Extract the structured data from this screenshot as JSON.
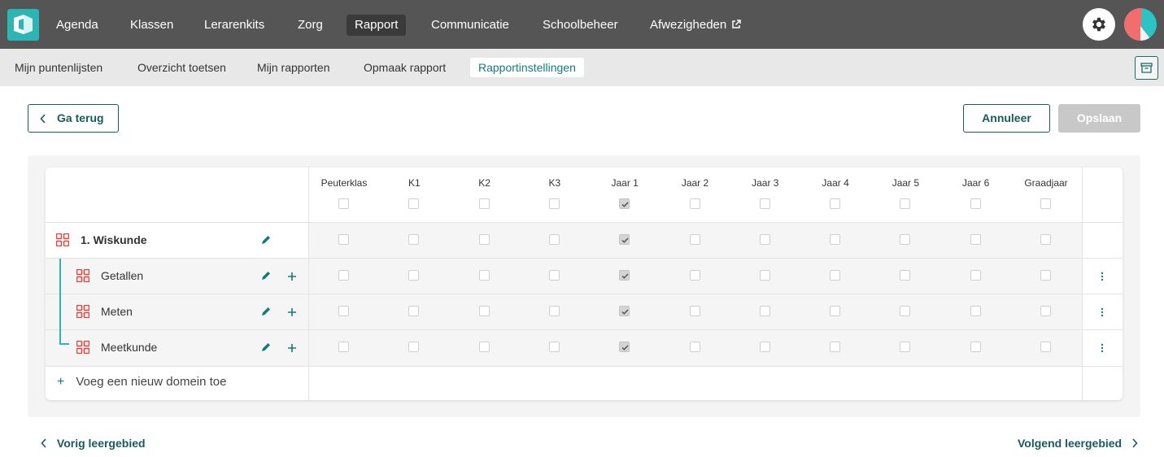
{
  "topnav": {
    "items": [
      "Agenda",
      "Klassen",
      "Lerarenkits",
      "Zorg",
      "Rapport",
      "Communicatie",
      "Schoolbeheer",
      "Afwezigheden"
    ],
    "active": "Rapport"
  },
  "subnav": {
    "items": [
      "Mijn puntenlijsten",
      "Overzicht toetsen",
      "Mijn rapporten",
      "Opmaak rapport",
      "Rapportinstellingen"
    ],
    "active": "Rapportinstellingen"
  },
  "actions": {
    "back": "Ga terug",
    "cancel": "Annuleer",
    "save": "Opslaan"
  },
  "table": {
    "columns": [
      "Peuterklas",
      "K1",
      "K2",
      "K3",
      "Jaar 1",
      "Jaar 2",
      "Jaar 3",
      "Jaar 4",
      "Jaar 5",
      "Jaar 6",
      "Graadjaar"
    ],
    "header_checked": [
      false,
      false,
      false,
      false,
      true,
      false,
      false,
      false,
      false,
      false,
      false
    ],
    "rows": [
      {
        "label": "1. Wiskunde",
        "level": 0,
        "checked": [
          false,
          false,
          false,
          false,
          true,
          false,
          false,
          false,
          false,
          false,
          false
        ]
      },
      {
        "label": "Getallen",
        "level": 1,
        "checked": [
          false,
          false,
          false,
          false,
          true,
          false,
          false,
          false,
          false,
          false,
          false
        ]
      },
      {
        "label": "Meten",
        "level": 1,
        "checked": [
          false,
          false,
          false,
          false,
          true,
          false,
          false,
          false,
          false,
          false,
          false
        ]
      },
      {
        "label": "Meetkunde",
        "level": 1,
        "checked": [
          false,
          false,
          false,
          false,
          true,
          false,
          false,
          false,
          false,
          false,
          false
        ]
      }
    ],
    "add_domain": "Voeg een nieuw domein toe"
  },
  "pager": {
    "prev": "Vorig leergebied",
    "next": "Volgend leergebied"
  },
  "colors": {
    "nav_bg": "#555555",
    "accent": "#127c7c",
    "brand": "#2bb5b5",
    "domain_icon": "#e8423f"
  },
  "icons": {
    "logo": "logo-icon",
    "external": "external-link-icon",
    "settings": "gear-icon",
    "archive": "archive-icon",
    "back": "chevron-left-icon",
    "next": "chevron-right-icon",
    "domain": "domain-grid-icon",
    "edit": "pencil-icon",
    "add": "plus-icon",
    "more": "more-vertical-icon"
  }
}
